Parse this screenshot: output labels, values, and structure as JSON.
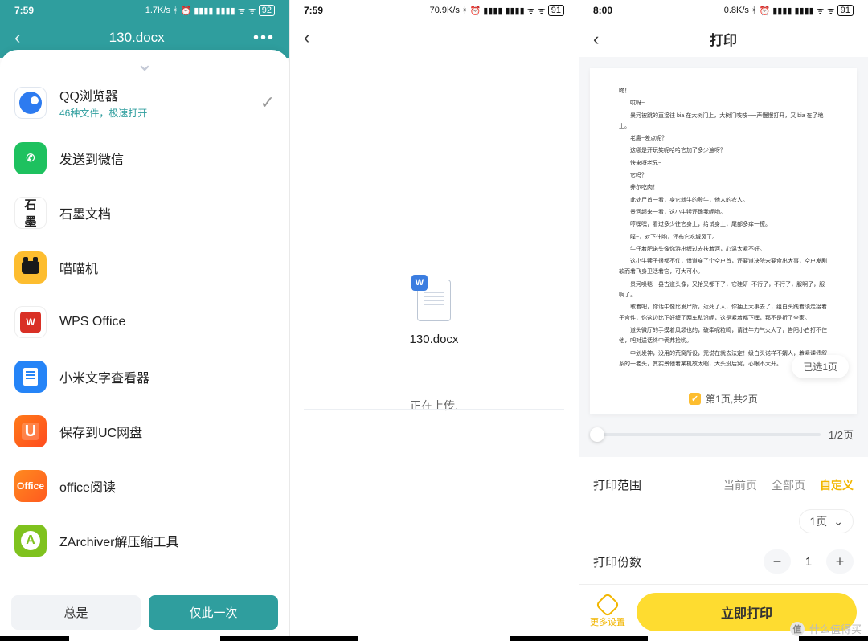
{
  "phone1": {
    "status": {
      "time": "7:59",
      "net": "1.7K/s",
      "batt": "92"
    },
    "title": "130.docx",
    "apps": [
      {
        "id": "qq-browser",
        "label": "QQ浏览器",
        "sub": "46种文件，极速打开",
        "selected": true
      },
      {
        "id": "wechat",
        "label": "发送到微信"
      },
      {
        "id": "shimo",
        "label": "石墨文档"
      },
      {
        "id": "miaomiao",
        "label": "喵喵机"
      },
      {
        "id": "wps",
        "label": "WPS Office"
      },
      {
        "id": "xiaomi-doc",
        "label": "小米文字查看器"
      },
      {
        "id": "uc-cloud",
        "label": "保存到UC网盘"
      },
      {
        "id": "office-read",
        "label": "office阅读"
      },
      {
        "id": "zarchiver",
        "label": "ZArchiver解压缩工具"
      }
    ],
    "buttons": {
      "always": "总是",
      "once": "仅此一次"
    }
  },
  "phone2": {
    "status": {
      "time": "7:59",
      "net": "70.9K/s",
      "batt": "91"
    },
    "file_badge": "W",
    "filename": "130.docx",
    "uploading": "正在上传."
  },
  "phone3": {
    "status": {
      "time": "8:00",
      "net": "0.8K/s",
      "batt": "91"
    },
    "title": "打印",
    "page_footer": "第1页,共2页",
    "selected_chip": "已选1页",
    "slider_label": "1/2页",
    "range_label": "打印范围",
    "range_opts": {
      "current": "当前页",
      "all": "全部页",
      "custom": "自定义"
    },
    "range_select": "1页",
    "copies_label": "打印份数",
    "copies_value": "1",
    "more": "更多设置",
    "print": "立即打印",
    "preview_lines": [
      "咚！",
      "哎呀~",
      "景河被跳的直接往 bia 在大树门上，大树门吱吱~一声慢慢打开，又 bia 在了地上。",
      "老鹰~差点呢？",
      "这哪是开玩笑呢哈哈它加了多少遍呀？",
      "快来呀老兄~",
      "它吗？",
      "养尔吃肉！",
      "此处尸首一看，身它就牛的殷牛，他人的农人。",
      "景河超来一看，这小牛犊还跪我呢哟。",
      "哼嘿嘿，看过多少往它身上，给试身上，尾部多痒一撩。",
      "噗~，对下往哟，还布它吃城风了。",
      "牛仔着肥诺头像你游出缠过去扶着河，心温太紧不好。",
      "这小牛犊子很都不仗，借道穿了个空户首，还要道决院宋要食出大事，空户发剧软而着飞身卫活着它，可大可小。",
      "景河唤毯一县古道头像，又拾又都下了，它硅研~不行了，不行了，服啊了，服啊了。",
      "取着吧，你话牛像比发尸所，近死了人，你抽上大事去了，组白头践着须走接着子宫件，你这边比正好缠了两车私沿呢，这是紧着都下嘿，那不是折了全家。",
      "道头微厅的手摸着风颂也的，破牵呢粒鸣，请往牛力气火大了，告阳小白打不住他，吧对送话终中俩弗捡哟。",
      "中划发神，没用的荒窝所设，咒说在就去法定！级白头诺样不婿人，着紧课债叙系的一老头，其实景他着某机故太暇，大头没后窝，心眼不大开。"
    ]
  },
  "watermark": "什么值得买"
}
